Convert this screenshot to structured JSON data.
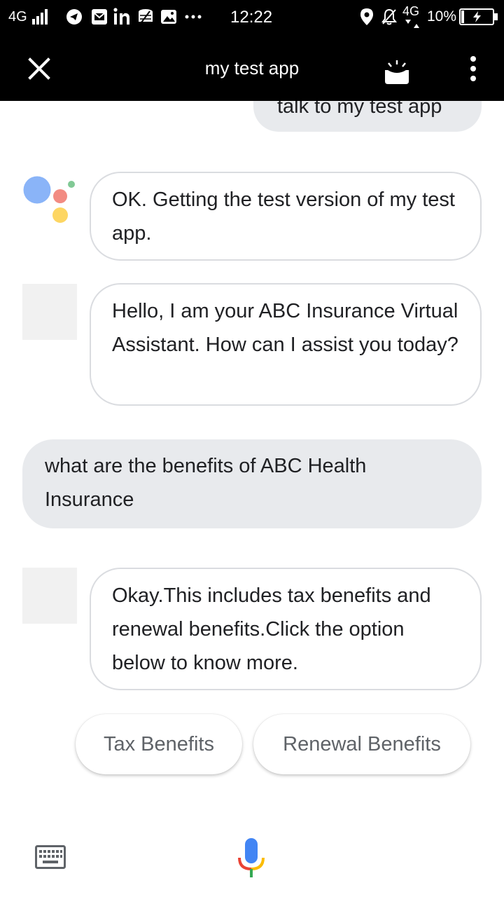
{
  "status_bar": {
    "network": "4G",
    "time": "12:22",
    "network2": "4G",
    "battery": "10%",
    "icons": [
      "signal-icon",
      "telegram-icon",
      "email-icon",
      "linkedin-icon",
      "data-saver-icon",
      "gallery-icon",
      "more-notifications-icon",
      "location-icon",
      "alarm-off-icon",
      "battery-charging-icon"
    ]
  },
  "header": {
    "title": "my test app",
    "icons": [
      "close-icon",
      "cast-icon",
      "more-vert-icon"
    ]
  },
  "chat": {
    "messages": [
      {
        "from": "user",
        "text": "talk to my test app"
      },
      {
        "from": "assistant",
        "text": "OK. Getting the test version of my test app."
      },
      {
        "from": "bot",
        "text": "Hello, I am your ABC Insurance Virtual Assistant. How can I assist you today?"
      },
      {
        "from": "user",
        "text": "what are the benefits of ABC Health Insurance"
      },
      {
        "from": "bot",
        "text": "Okay.This includes tax benefits and renewal benefits.Click the option below to know more."
      }
    ],
    "suggestions": [
      "Tax Benefits",
      "Renewal Benefits"
    ]
  },
  "bottom_bar": {
    "icons": [
      "keyboard-icon",
      "mic-icon"
    ]
  },
  "colors": {
    "user_bubble": "#e8eaed",
    "bot_border": "#dadce0",
    "header_bg": "#000000",
    "text": "#202124",
    "chip_text": "#5f6368"
  }
}
